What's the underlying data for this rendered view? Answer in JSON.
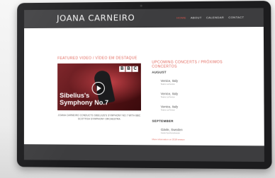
{
  "site": {
    "title": "JOANA CARNEIRO",
    "nav": [
      "HOME",
      "ABOUT",
      "CALENDAR",
      "CONTACT"
    ],
    "active_nav": "HOME"
  },
  "featured": {
    "heading": "FEATURED VIDEO / VÍDEO EM DESTAQUE",
    "video_title_line1": "Sibelius's",
    "video_title_line2": "Symphony No.7",
    "bbc_letters": [
      "B",
      "B",
      "C"
    ],
    "caption": "JOANA CARNEIRO CONDUCTS SIBELIUS'S SYMPHONY NO.7 WITH BBC SCOTTISH SYMPHONY ORCHESTRA"
  },
  "concerts": {
    "heading": "UPCOMING CONCERTS / PRÓXIMOS CONCERTOS",
    "months": [
      {
        "name": "AUGUST",
        "items": [
          {
            "city": "Venice, Italy",
            "venue": "Teatro La Fenice"
          },
          {
            "city": "Venice, Italy",
            "venue": "Teatro La Fenice"
          },
          {
            "city": "Venice, Italy",
            "venue": "Teatro La Fenice"
          }
        ]
      },
      {
        "name": "SEPTEMBER",
        "items": [
          {
            "city": "Gävle, Sweden",
            "venue": "Gavle Symfoniorkester"
          }
        ]
      }
    ],
    "more_link": "More information on 2018 season"
  },
  "colors": {
    "accent": "#e1665b",
    "header_bg": "#3d3d3f",
    "monitor_frame": "#1c1c1e"
  }
}
